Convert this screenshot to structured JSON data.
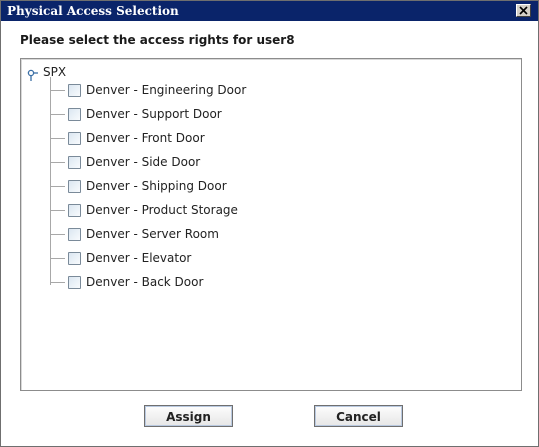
{
  "window": {
    "title": "Physical Access Selection"
  },
  "prompt": "Please select the access rights for user8",
  "tree": {
    "root_label": "SPX",
    "items": [
      {
        "label": "Denver - Engineering Door",
        "checked": false
      },
      {
        "label": "Denver - Support Door",
        "checked": false
      },
      {
        "label": "Denver - Front Door",
        "checked": false
      },
      {
        "label": "Denver - Side Door",
        "checked": false
      },
      {
        "label": "Denver - Shipping Door",
        "checked": false
      },
      {
        "label": "Denver - Product Storage",
        "checked": false
      },
      {
        "label": "Denver - Server Room",
        "checked": false
      },
      {
        "label": "Denver - Elevator",
        "checked": false
      },
      {
        "label": "Denver - Back Door",
        "checked": false
      }
    ]
  },
  "buttons": {
    "assign_label": "Assign",
    "cancel_label": "Cancel"
  },
  "colors": {
    "titlebar": "#0a246a",
    "title_text": "#ffffff"
  },
  "icons": {
    "close": "close-icon",
    "root": "tree-root-handle-icon"
  }
}
